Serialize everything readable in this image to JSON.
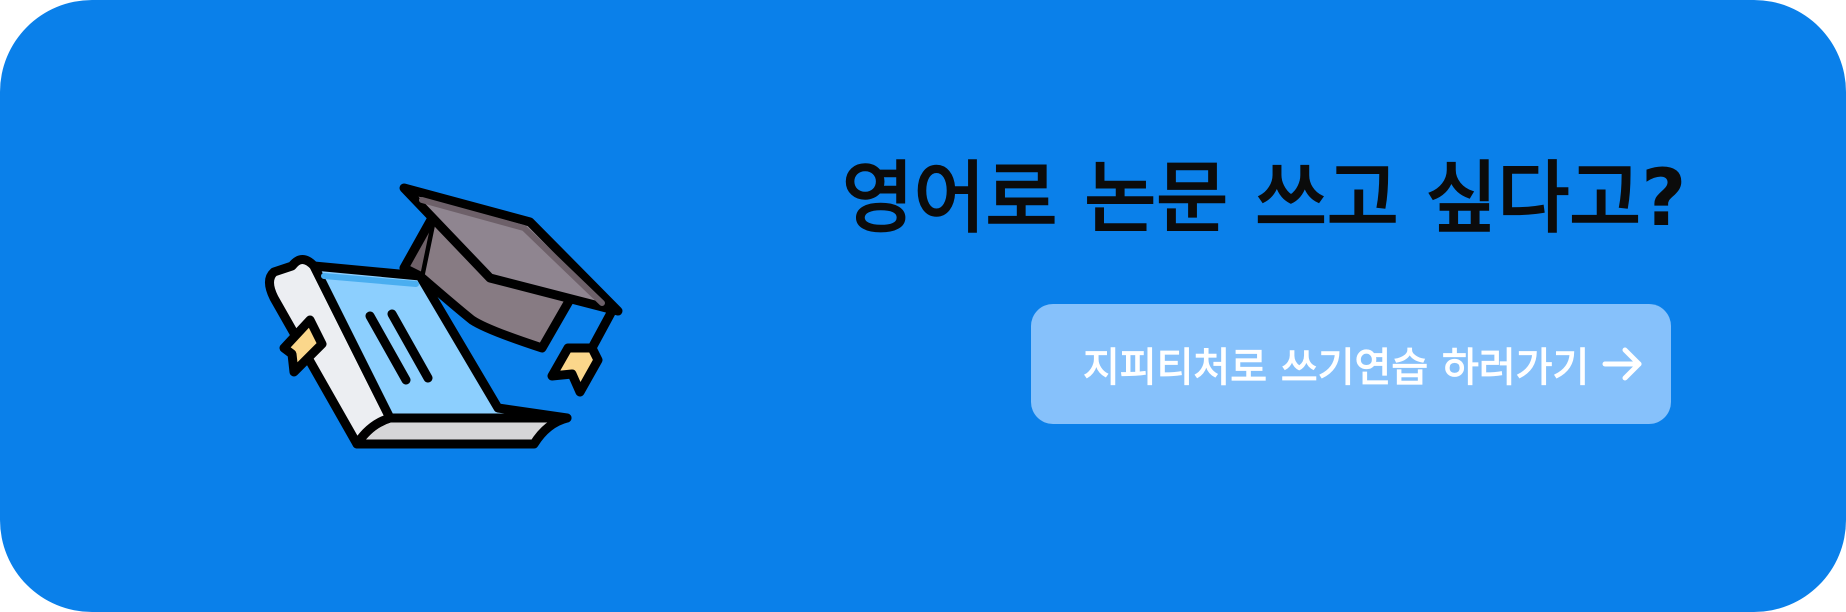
{
  "banner": {
    "headline": "영어로 논문 쓰고 싶다고?",
    "cta_label": "지피티처로 쓰기연습 하러가기",
    "illustration_icon": "graduation-book-icon",
    "arrow_icon": "arrow-right-icon"
  },
  "colors": {
    "background": "#0a80ea",
    "button": "#86c1fb",
    "headline_text": "#0b0b0b",
    "button_text": "#ffffff"
  }
}
